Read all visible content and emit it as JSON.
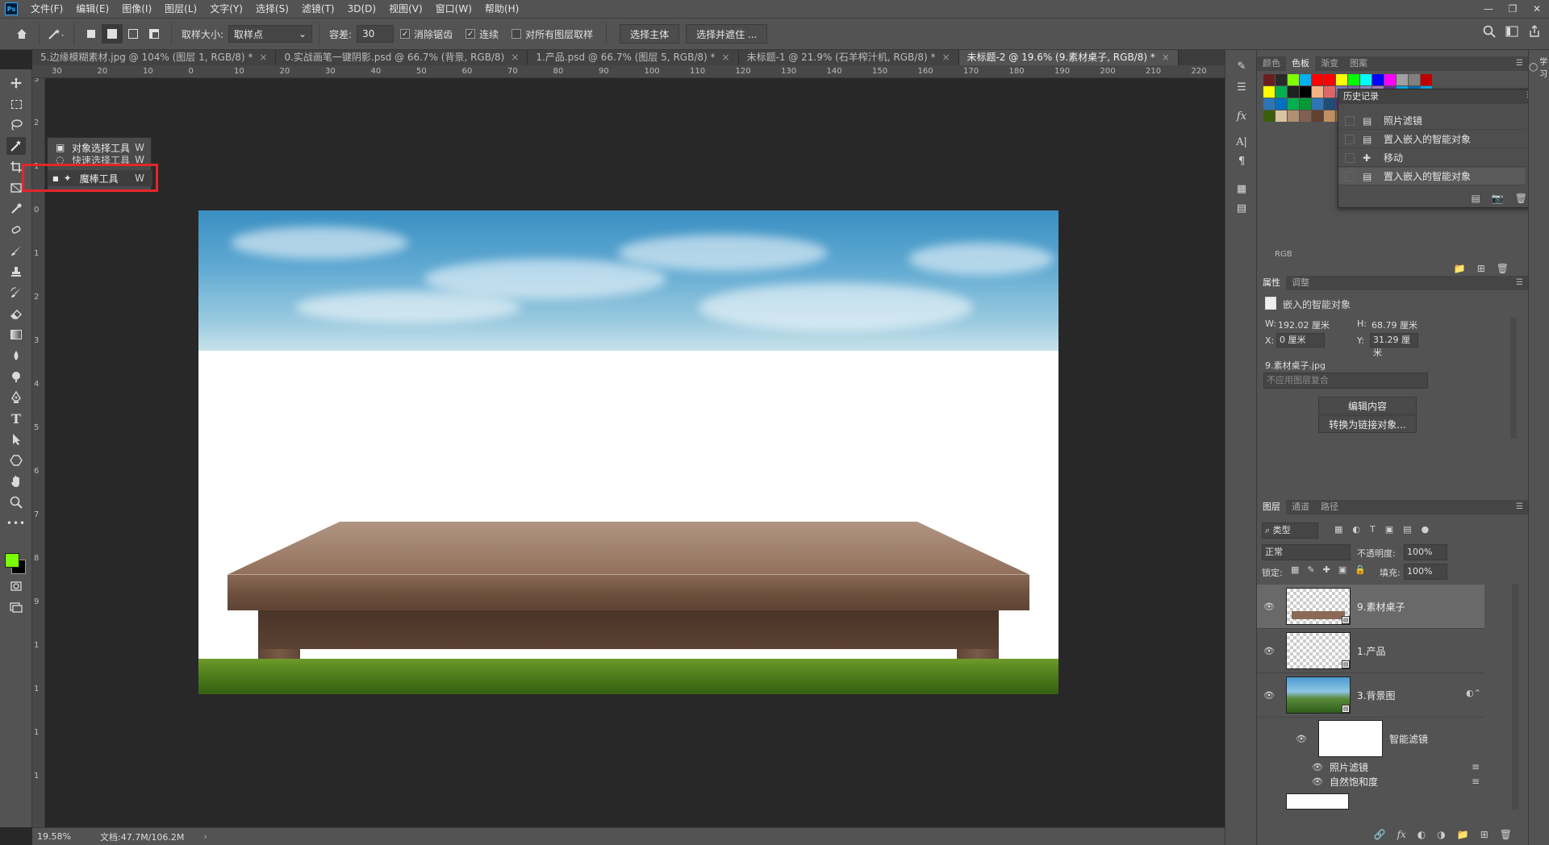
{
  "app": {
    "logo_text": "Ps",
    "menus": [
      "文件(F)",
      "编辑(E)",
      "图像(I)",
      "图层(L)",
      "文字(Y)",
      "选择(S)",
      "滤镜(T)",
      "3D(D)",
      "视图(V)",
      "窗口(W)",
      "帮助(H)"
    ]
  },
  "options": {
    "sample_size_label": "取样大小:",
    "sample_size_value": "取样点",
    "tolerance_label": "容差:",
    "tolerance_value": "30",
    "antialias_label": "消除锯齿",
    "antialias_checked": true,
    "contiguous_label": "连续",
    "contiguous_checked": true,
    "sample_all_label": "对所有图层取样",
    "sample_all_checked": false,
    "select_subject": "选择主体",
    "select_and_mask": "选择并遮住 ..."
  },
  "tabs": [
    {
      "label": "5.边缘模糊素材.jpg @ 104% (图层 1, RGB/8) *"
    },
    {
      "label": "0.实战画笔一键阴影.psd @ 66.7% (背景, RGB/8)"
    },
    {
      "label": "1.产品.psd @ 66.7% (图层 5, RGB/8) *"
    },
    {
      "label": "未标题-1 @ 21.9% (石羊榨汁机, RGB/8) *"
    },
    {
      "label": "未标题-2 @ 19.6% (9.素材桌子, RGB/8) *"
    }
  ],
  "ruler": {
    "top_labels": [
      "30",
      "20",
      "10",
      "0",
      "10",
      "20",
      "30",
      "40",
      "50",
      "60",
      "70",
      "80",
      "90",
      "100",
      "110",
      "120",
      "130",
      "140",
      "150",
      "160",
      "170",
      "180",
      "190",
      "200",
      "210",
      "220"
    ],
    "left_labels": [
      "3",
      "2",
      "1",
      "0",
      "1",
      "2",
      "3",
      "4",
      "5",
      "6",
      "7",
      "8",
      "9",
      "1",
      "1",
      "1",
      "1"
    ]
  },
  "flyout": {
    "items": [
      {
        "label": "对象选择工具",
        "key": "W"
      },
      {
        "label": "快速选择工具",
        "key": "W"
      },
      {
        "label": "魔棒工具",
        "key": "W"
      }
    ]
  },
  "swatches_panel": {
    "tabs": [
      "颜色",
      "色板",
      "渐变",
      "图案"
    ],
    "active": "色板",
    "colors": [
      "#6a1e1e",
      "#2a2a2a",
      "#7fff00",
      "#00b0f0",
      "#ff0000",
      "#ff0000",
      "#ffff00",
      "#00ff00",
      "#00ffff",
      "#0000ff",
      "#ff00ff",
      "#a0a0a0",
      "#808080",
      "#c00000",
      "#ffff00",
      "#00b050",
      "#202020",
      "#000000",
      "#f4b183",
      "#e06666",
      "#8080c0",
      "#8070b0",
      "#9090d0",
      "#b080c0",
      "#7030a0",
      "#00b0f0",
      "#0070c0",
      "#00b0f0",
      "#2e75b6",
      "#0070c0",
      "#00b050",
      "#009933",
      "#2e75b6",
      "#1f4e79",
      "#7030a0",
      "#70ad47",
      "#00b050",
      "#2e7d32",
      "#006400",
      "#808000",
      "#bf9000",
      "#7f6000",
      "#3a5f0b",
      "#d9c3a0",
      "#b09070",
      "#806050",
      "#604030",
      "#c09060",
      "#a07040",
      "#806030",
      "#604020",
      "#00ffff",
      "#ffc000",
      "#1f1f1f",
      "#2f4f2f",
      "#3c5a2a"
    ],
    "group_label": "RGB"
  },
  "history": {
    "title": "历史记录",
    "items": [
      {
        "label": "照片滤镜",
        "icon": "document-icon",
        "selected": false
      },
      {
        "label": "置入嵌入的智能对象",
        "icon": "document-icon",
        "selected": false
      },
      {
        "label": "移动",
        "icon": "move-icon",
        "selected": false
      },
      {
        "label": "置入嵌入的智能对象",
        "icon": "document-icon",
        "selected": true
      }
    ]
  },
  "properties": {
    "tabs": [
      "属性",
      "调整"
    ],
    "type_label": "嵌入的智能对象",
    "w_label": "W:",
    "w_value": "192.02 厘米",
    "h_label": "H:",
    "h_value": "68.79 厘米",
    "x_label": "X:",
    "x_value": "0 厘米",
    "y_label": "Y:",
    "y_value": "31.29 厘米",
    "filename": "9.素材桌子.jpg",
    "comp_placeholder": "不应用图层复合",
    "edit_contents": "编辑内容",
    "convert_linked": "转换为链接对象..."
  },
  "layers": {
    "tabs": [
      "图层",
      "通道",
      "路径"
    ],
    "filter_label": "类型",
    "blend_mode": "正常",
    "opacity_label": "不透明度:",
    "opacity_value": "100%",
    "lock_label": "锁定:",
    "fill_label": "填充:",
    "fill_value": "100%",
    "items": [
      {
        "name": "9.素材桌子",
        "selected": true
      },
      {
        "name": "1.产品",
        "selected": false
      },
      {
        "name": "3.背景图",
        "selected": false
      }
    ],
    "smart_filters_label": "智能滤镜",
    "filters": [
      "照片滤镜",
      "自然饱和度"
    ]
  },
  "status": {
    "zoom": "19.58%",
    "doc": "文档:47.7M/106.2M"
  },
  "right_edge": {
    "learn_label": "学习"
  }
}
